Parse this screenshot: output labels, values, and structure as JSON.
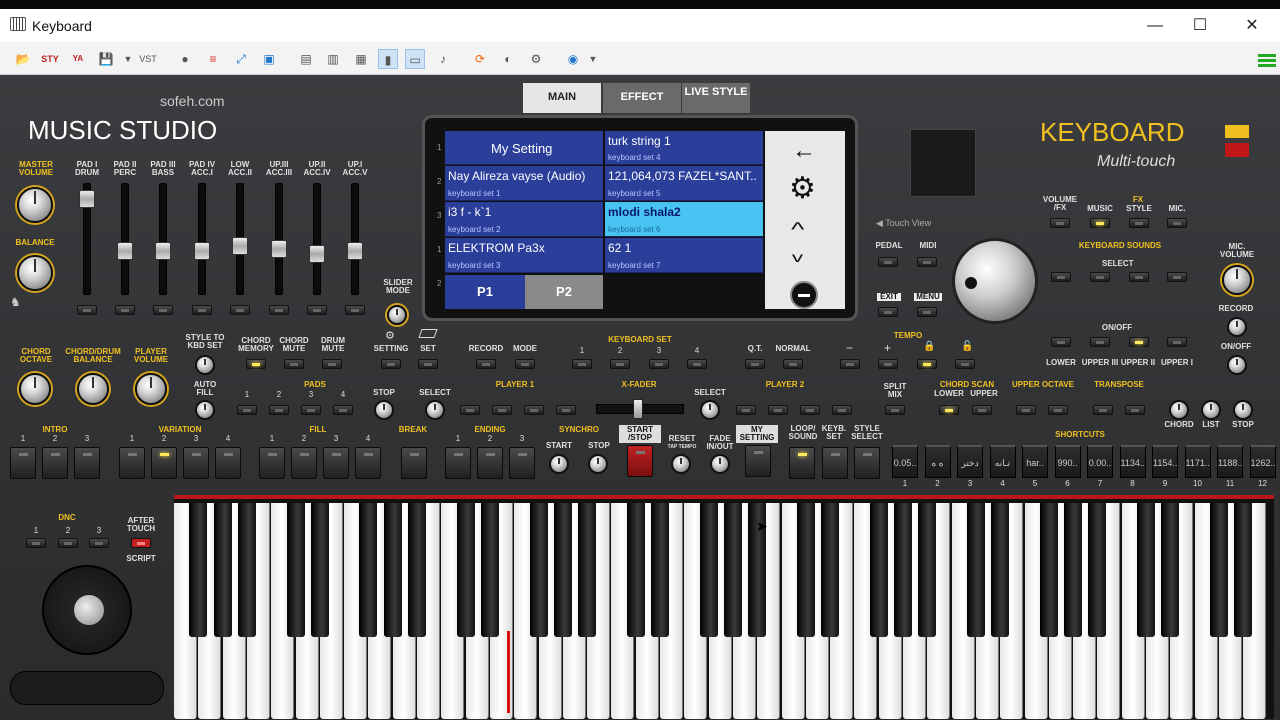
{
  "window": {
    "title": "Keyboard",
    "min": "—",
    "max": "☐",
    "close": "✕"
  },
  "brand": {
    "site": "sofeh.com",
    "studio": "MUSIC STUDIO",
    "keyboard": "KEYBOARD",
    "multitouch": "Multi-touch"
  },
  "tabs": [
    "MAIN",
    "EFFECT",
    "LIVE STYLE"
  ],
  "mixer": {
    "master_volume": "MASTER VOLUME",
    "balance": "BALANCE",
    "slider_mode": "SLIDER MODE",
    "channels": [
      "PAD I DRUM",
      "PAD II PERC",
      "PAD III BASS",
      "PAD IV ACC.I",
      "LOW ACC.II",
      "UP.III ACC.III",
      "UP.II ACC.IV",
      "UP.I ACC.V"
    ]
  },
  "screen": {
    "left": [
      {
        "main": "My Setting",
        "sub": ""
      },
      {
        "main": "Nay Alireza vayse (Audio)",
        "sub": "keyboard set 1"
      },
      {
        "main": "i3 f - k`1",
        "sub": "keyboard set 2"
      },
      {
        "main": "ELEKTROM  Pa3x",
        "sub": "keyboard set 3"
      }
    ],
    "right": [
      {
        "main": "turk string 1",
        "sub": "keyboard set 4"
      },
      {
        "main": "121,064,073 FAZEL*SANT..",
        "sub": "keyboard set 5"
      },
      {
        "main": "mlodi shala2",
        "sub": "keyboard set 6"
      },
      {
        "main": "62 1",
        "sub": "keyboard set 7"
      }
    ],
    "pages": [
      "P1",
      "P2"
    ],
    "side_numbers": [
      "1",
      "2",
      "3",
      "1",
      "2"
    ],
    "side_icons": [
      "back-arrow",
      "gear",
      "chevron-up",
      "chevron-down",
      "minus-circle"
    ]
  },
  "touch_view": "◀ Touch View",
  "labels": {
    "chord_octave": "CHORD OCTAVE",
    "chord_drum_balance": "CHORD/DRUM BALANCE",
    "player_volume": "PLAYER VOLUME",
    "style_to_kbd": "STYLE TO KBD SET",
    "chord_memory": "CHORD MEMORY",
    "chord_mute": "CHORD MUTE",
    "drum_mute": "DRUM MUTE",
    "setting": "SETTING",
    "set": "SET",
    "record": "RECORD",
    "mode": "MODE",
    "keyboard_set": "KEYBOARD SET",
    "qt": "Q.T.",
    "normal": "NORMAL",
    "tempo": "TEMPO",
    "auto_fill": "AUTO FILL",
    "pads": "PADS",
    "stop": "STOP",
    "select": "SELECT",
    "player1": "PLAYER 1",
    "xfader": "X-FADER",
    "player2": "PLAYER 2",
    "split_mix": "SPLIT MIX",
    "chord_scan": "CHORD SCAN",
    "lower": "LOWER",
    "upper": "UPPER",
    "upper_octave": "UPPER OCTAVE",
    "transpose": "TRANSPOSE",
    "chord": "CHORD",
    "list": "LIST",
    "intro": "INTRO",
    "variation": "VARIATION",
    "fill": "FILL",
    "break": "BREAK",
    "ending": "ENDING",
    "synchro": "SYNCHRO",
    "start": "START",
    "start_stop": "START /STOP",
    "reset": "RESET",
    "tap_tempo": "TAP TEMPO",
    "fade": "FADE IN/OUT",
    "my_setting": "MY SETTING",
    "loop_sound": "LOOP/ SOUND",
    "keyb_set": "KEYB. SET",
    "style_select": "STYLE SELECT",
    "shortcuts": "SHORTCUTS",
    "dnc": "DNC",
    "after_touch": "AFTER TOUCH",
    "script": "SCRIPT",
    "pedal": "PEDAL",
    "midi": "MIDI",
    "exit": "EXIT",
    "menu": "MENU",
    "volume_fx": "VOLUME /FX",
    "fx": "FX",
    "music": "MUSIC",
    "style": "STYLE",
    "mic": "MIC.",
    "keyboard_sounds": "KEYBOARD SOUNDS",
    "on_off": "ON/OFF",
    "lower2": "LOWER",
    "upper3": "UPPER III",
    "upper2": "UPPER II",
    "upper1": "UPPER I",
    "mic_volume": "MIC. VOLUME",
    "record2": "RECORD",
    "on_off2": "ON/OFF"
  },
  "shortcuts": [
    "0.05..",
    "ه ه",
    "دختر",
    "تـانه",
    "har..",
    "990..",
    "0.00..",
    "1134..",
    "1154..",
    "1171..",
    "1188..",
    "1262.."
  ],
  "shortcut_nums": [
    "1",
    "2",
    "3",
    "4",
    "5",
    "6",
    "7",
    "8",
    "9",
    "10",
    "11",
    "12"
  ],
  "colors": {
    "accent_yellow": "#f0c020",
    "screen_blue": "#2a3e9a",
    "screen_highlight": "#49c3f2",
    "red_line": "#b81818"
  }
}
